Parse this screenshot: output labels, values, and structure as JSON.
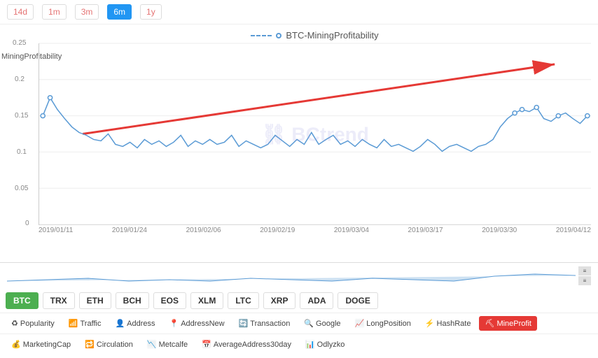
{
  "timeButtons": [
    {
      "label": "14d",
      "active": false
    },
    {
      "label": "1m",
      "active": false
    },
    {
      "label": "3m",
      "active": false
    },
    {
      "label": "6m",
      "active": true
    },
    {
      "label": "1y",
      "active": false
    }
  ],
  "chartTitle": "BTC-MiningProfitability",
  "yAxisLabel": "MiningProfitability",
  "yTicks": [
    "0.25",
    "0.2",
    "0.15",
    "0.1",
    "0.05",
    "0"
  ],
  "xLabels": [
    "2019/01/11",
    "2019/01/24",
    "2019/02/06",
    "2019/02/19",
    "2019/03/04",
    "2019/03/17",
    "2019/03/30",
    "2019/04/12"
  ],
  "watermark": "BCtrend",
  "coins": [
    {
      "label": "BTC",
      "active": true
    },
    {
      "label": "TRX",
      "active": false
    },
    {
      "label": "ETH",
      "active": false
    },
    {
      "label": "BCH",
      "active": false
    },
    {
      "label": "EOS",
      "active": false
    },
    {
      "label": "XLM",
      "active": false
    },
    {
      "label": "LTC",
      "active": false
    },
    {
      "label": "XRP",
      "active": false
    },
    {
      "label": "ADA",
      "active": false
    },
    {
      "label": "DOGE",
      "active": false
    }
  ],
  "metrics1": [
    {
      "icon": "♻",
      "label": "Popularity"
    },
    {
      "icon": "📶",
      "label": "Traffic"
    },
    {
      "icon": "👤",
      "label": "Address"
    },
    {
      "icon": "📍",
      "label": "AddressNew"
    },
    {
      "icon": "🔄",
      "label": "Transaction"
    },
    {
      "icon": "🔍",
      "label": "Google"
    },
    {
      "icon": "📈",
      "label": "LongPosition"
    },
    {
      "icon": "⚡",
      "label": "HashRate"
    },
    {
      "icon": "⛏",
      "label": "MineProfit",
      "active": true
    }
  ],
  "metrics2": [
    {
      "icon": "💰",
      "label": "MarketingCap"
    },
    {
      "icon": "🔁",
      "label": "Circulation"
    },
    {
      "icon": "📉",
      "label": "Metcalfe"
    },
    {
      "icon": "📅",
      "label": "AverageAddress30day"
    },
    {
      "icon": "📊",
      "label": "Odlyzko"
    }
  ]
}
